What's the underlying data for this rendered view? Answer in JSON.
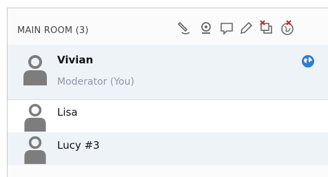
{
  "room": {
    "title": "MAIN ROOM (3)"
  },
  "toolbar": {
    "icons": [
      "draw-tool-icon",
      "webcam-icon",
      "chat-icon",
      "pencil-icon",
      "screen-share-icon",
      "globe-permission-icon"
    ]
  },
  "users": [
    {
      "name": "Vivian",
      "role": "Moderator (You)",
      "selected": true,
      "has_globe": true
    },
    {
      "name": "Lisa"
    },
    {
      "name": "Lucy #3"
    }
  ],
  "colors": {
    "accent_blue": "#2f7fd0",
    "avatar_gray": "#7d7d7d",
    "remove_red": "#d9281e"
  }
}
